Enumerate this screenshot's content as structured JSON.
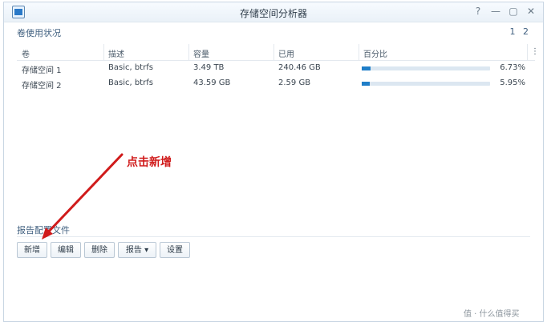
{
  "window": {
    "title": "存储空间分析器"
  },
  "window_controls": {
    "help": "?",
    "minimize": "—",
    "restore": "▢",
    "close": "✕"
  },
  "volume_section": {
    "title": "卷使用状况",
    "pages": [
      "1",
      "2"
    ]
  },
  "table": {
    "headers": [
      "卷",
      "描述",
      "容量",
      "已用",
      "百分比"
    ],
    "rows": [
      {
        "volume": "存储空间 1",
        "description": "Basic, btrfs",
        "capacity": "3.49 TB",
        "used": "240.46 GB",
        "percent": "6.73%",
        "ratio": 0.0673
      },
      {
        "volume": "存储空间 2",
        "description": "Basic, btrfs",
        "capacity": "43.59 GB",
        "used": "2.59 GB",
        "percent": "5.95%",
        "ratio": 0.0595
      }
    ]
  },
  "report_section": {
    "title": "报告配置文件"
  },
  "toolbar": {
    "add": "新增",
    "edit": "编辑",
    "delete": "删除",
    "report": "报告 ▾",
    "settings": "设置"
  },
  "annotation": {
    "text": "点击新增"
  },
  "watermark": {
    "text": "值 · 什么值得买"
  },
  "colors": {
    "accent": "#1f7ec8",
    "annotation": "#d01b1b"
  }
}
